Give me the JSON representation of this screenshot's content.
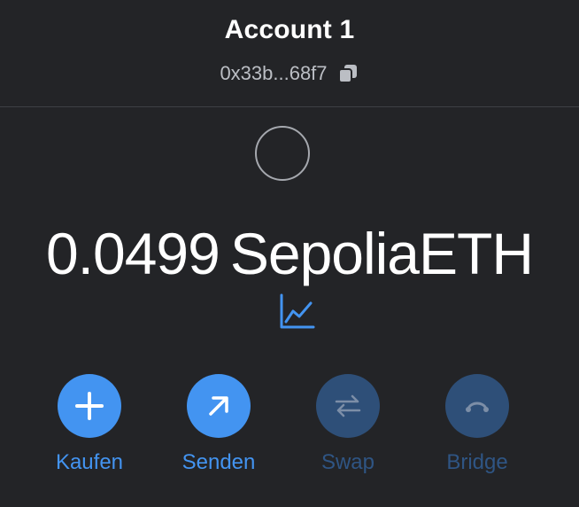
{
  "account": {
    "name": "Account 1",
    "address": "0x33b...68f7"
  },
  "balance": {
    "amount": "0.0499",
    "currency": "SepoliaETH"
  },
  "colors": {
    "background": "#232427",
    "accent": "#4394f1",
    "disabled_button": "#2e4f78",
    "disabled_label": "#2f5584"
  },
  "actions": [
    {
      "label": "Kaufen",
      "icon": "plus-icon",
      "enabled": true
    },
    {
      "label": "Senden",
      "icon": "arrow-up-right-icon",
      "enabled": true
    },
    {
      "label": "Swap",
      "icon": "swap-arrows-icon",
      "enabled": false
    },
    {
      "label": "Bridge",
      "icon": "bridge-icon",
      "enabled": false
    }
  ],
  "icons": {
    "copy": "copy-icon",
    "chart": "chart-line-icon",
    "avatar": "account-avatar"
  }
}
